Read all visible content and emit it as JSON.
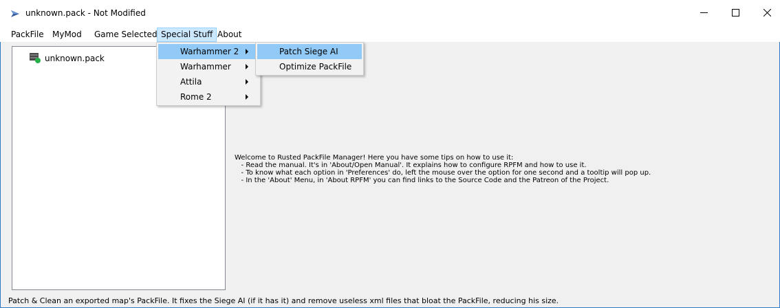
{
  "window": {
    "title": "unknown.pack - Not Modified"
  },
  "menubar": {
    "items": [
      "PackFile",
      "MyMod",
      "Game Selected",
      "Special Stuff",
      "About"
    ]
  },
  "special_stuff_menu": {
    "items": [
      {
        "label": "Warhammer 2",
        "has_submenu": true
      },
      {
        "label": "Warhammer",
        "has_submenu": true
      },
      {
        "label": "Attila",
        "has_submenu": true
      },
      {
        "label": "Rome 2",
        "has_submenu": true
      }
    ]
  },
  "warhammer2_submenu": {
    "items": [
      "Patch Siege AI",
      "Optimize PackFile"
    ]
  },
  "tree": {
    "root_label": "unknown.pack"
  },
  "welcome": {
    "lines": [
      "Welcome to Rusted PackFile Manager! Here you have some tips on how to use it:",
      "   - Read the manual. It's in 'About/Open Manual'. It explains how to configure RPFM and how to use it.",
      "   - To know what each option in 'Preferences' do, left the mouse over the option for one second and a tooltip will pop up.",
      "   - In the 'About' Menu, in 'About RPFM' you can find links to the Source Code and the Patreon of the Project."
    ]
  },
  "statusbar": {
    "text": "Patch & Clean an exported map's PackFile. It fixes the Siege AI (if it has it) and remove useless xml files that bloat the PackFile, reducing his size."
  },
  "colors": {
    "accent": "#2b78c4",
    "menu_highlight": "#91c9f7",
    "menubar_open": "#cce8ff"
  }
}
